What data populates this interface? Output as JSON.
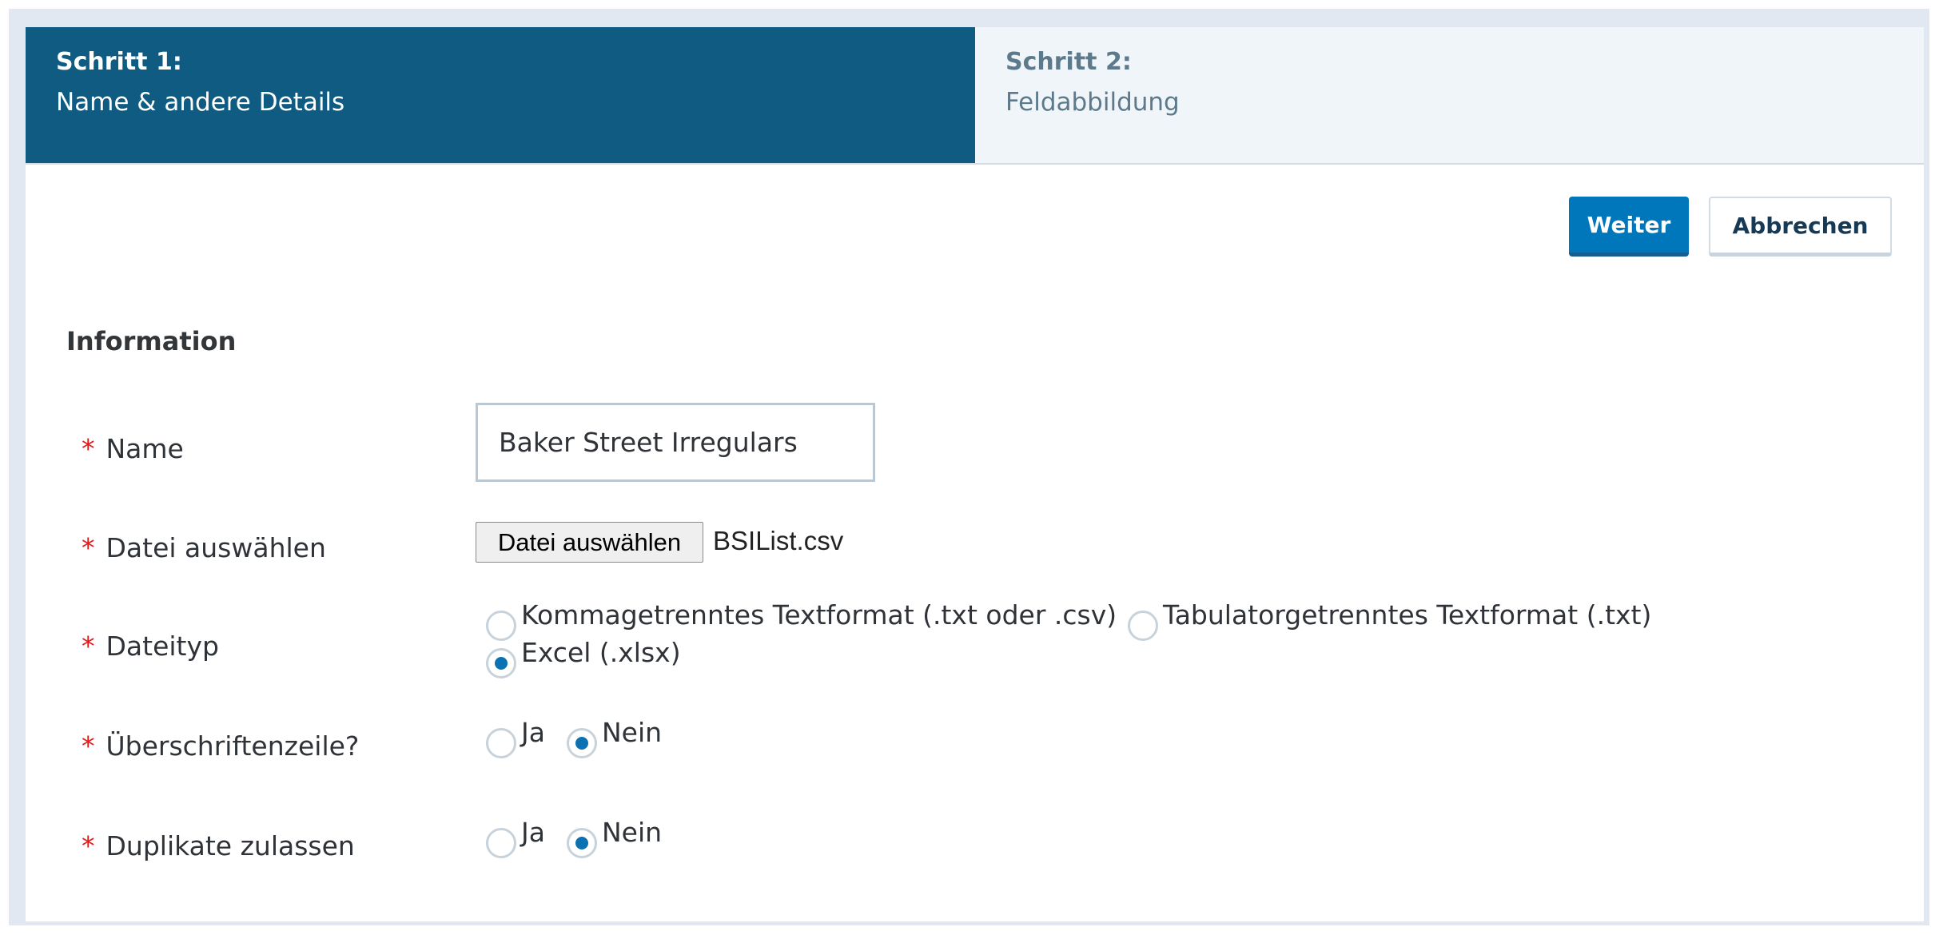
{
  "steps": [
    {
      "number": "Schritt 1:",
      "description": "Name & andere Details",
      "active": true
    },
    {
      "number": "Schritt 2:",
      "description": "Feldabbildung",
      "active": false
    }
  ],
  "actions": {
    "next_label": "Weiter",
    "cancel_label": "Abbrechen"
  },
  "colors": {
    "active_step": "#0f5b82",
    "primary_button": "#0077bb",
    "required": "#e3191c",
    "radio_checked": "#0a72b2"
  },
  "section": {
    "title": "Information"
  },
  "required_marker": "*",
  "form": {
    "name": {
      "label": "Name",
      "value": "Baker Street Irregulars"
    },
    "file": {
      "label": "Datei auswählen",
      "button_label": "Datei auswählen",
      "file_name": "BSIList.csv"
    },
    "file_type": {
      "label": "Dateityp",
      "options": [
        {
          "label": "Kommagetrenntes Textformat (.txt oder .csv)",
          "checked": false
        },
        {
          "label": "Tabulatorgetrenntes Textformat (.txt)",
          "checked": false
        },
        {
          "label": "Excel (.xlsx)",
          "checked": true
        }
      ]
    },
    "header_row": {
      "label": "Überschriftenzeile?",
      "options": [
        {
          "label": "Ja",
          "checked": false
        },
        {
          "label": "Nein",
          "checked": true
        }
      ]
    },
    "allow_duplicates": {
      "label": "Duplikate zulassen",
      "options": [
        {
          "label": "Ja",
          "checked": false
        },
        {
          "label": "Nein",
          "checked": true
        }
      ]
    }
  }
}
